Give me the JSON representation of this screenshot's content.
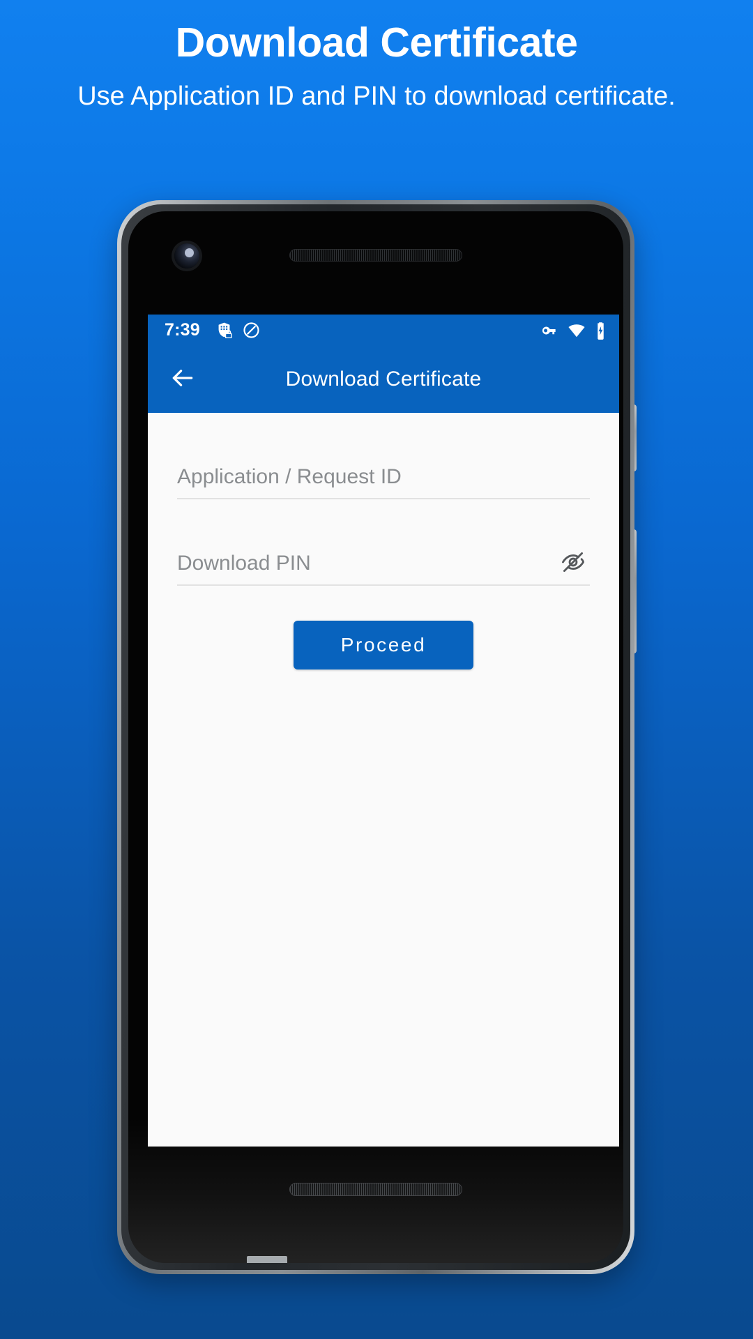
{
  "promo": {
    "title": "Download Certificate",
    "subtitle": "Use Application ID and PIN to download certificate."
  },
  "colors": {
    "background_top": "#1180ef",
    "background_bottom": "#094a8f",
    "accent": "#0863be",
    "screen_background": "#fafafa",
    "hint_text": "#8a8d90"
  },
  "phone": {
    "hardware": {
      "front_camera": "front-camera-icon",
      "top_speaker": "top-speaker-grille",
      "bottom_speaker": "bottom-speaker-grille",
      "power_button": "power-button",
      "volume_button": "volume-button"
    }
  },
  "screen": {
    "status_bar": {
      "clock": "7:39",
      "left_icons": [
        "shield-lock-icon",
        "do-not-disturb-icon"
      ],
      "right_icons": [
        "vpn-key-icon",
        "wifi-icon",
        "battery-charging-icon"
      ]
    },
    "app_bar": {
      "back_icon": "arrow-left-icon",
      "title": "Download Certificate"
    },
    "form": {
      "fields": [
        {
          "name": "application-request-id",
          "placeholder": "Application / Request ID",
          "value": "",
          "trailing_icon": ""
        },
        {
          "name": "download-pin",
          "placeholder": "Download PIN",
          "value": "",
          "trailing_icon": "eye-off-icon"
        }
      ],
      "submit_label": "Proceed"
    }
  }
}
